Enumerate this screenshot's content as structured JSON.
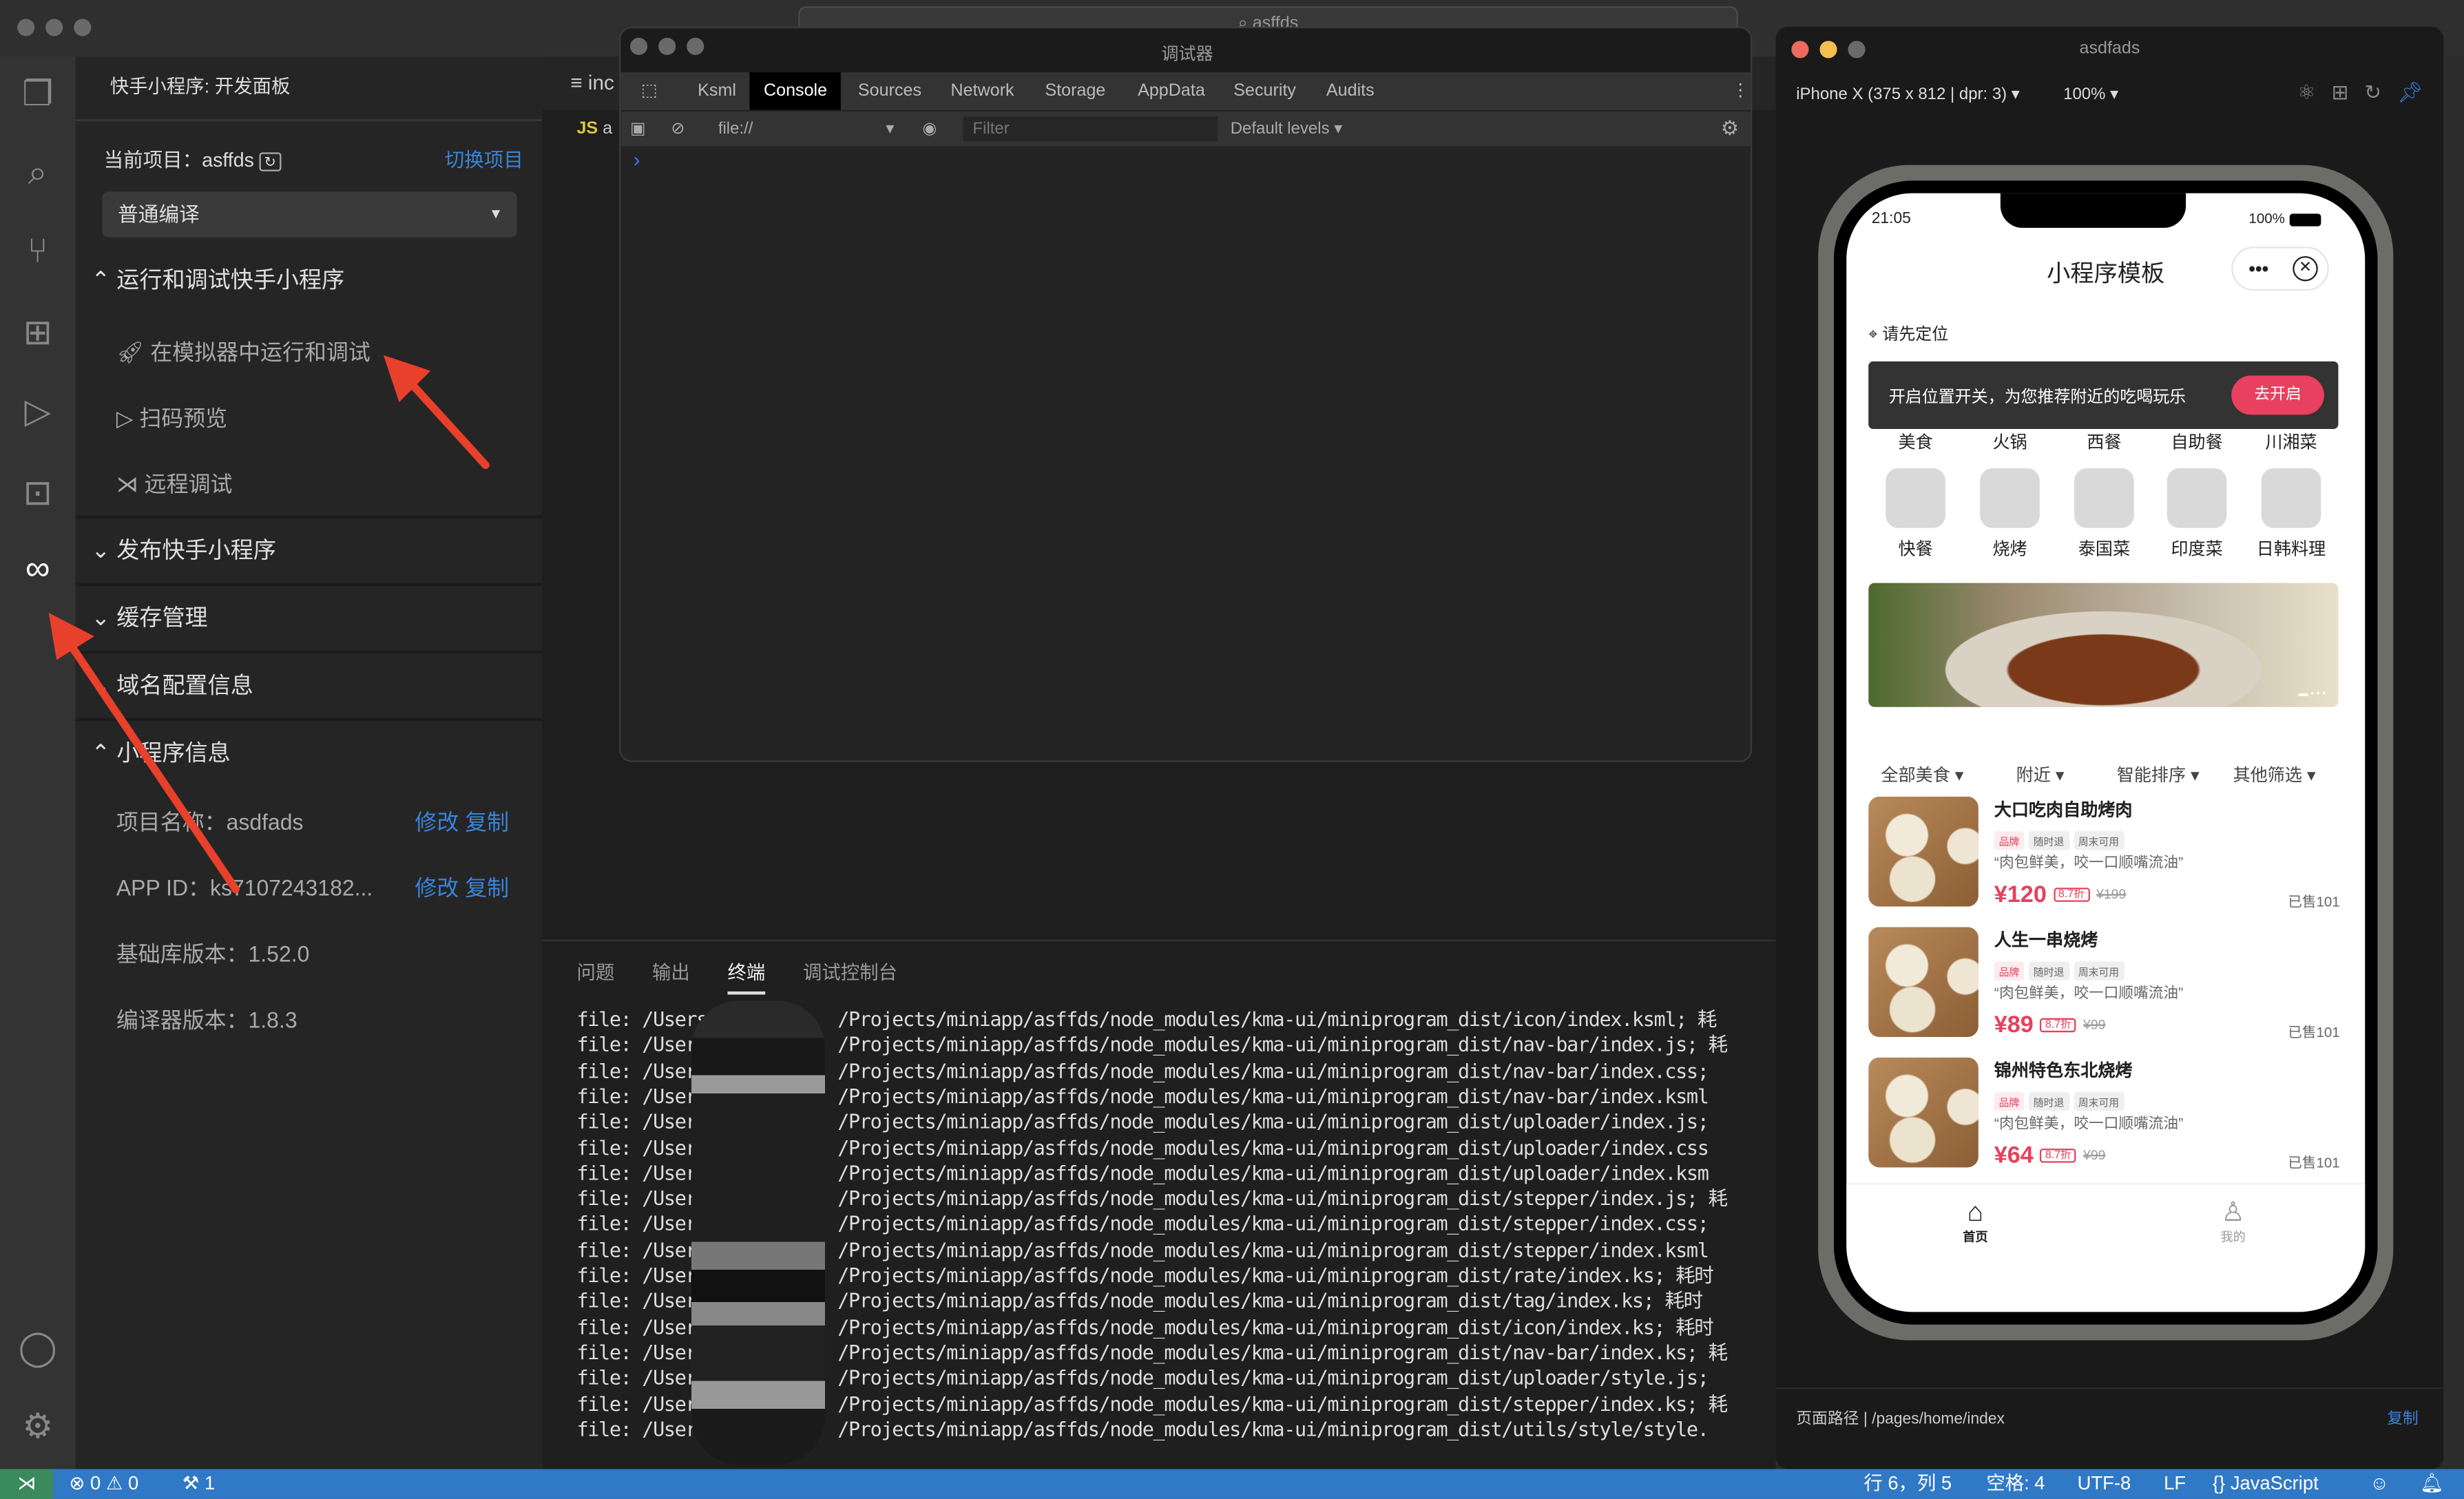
{
  "ide": {
    "sidebar": {
      "title": "快手小程序: 开发面板",
      "current_project_label": "当前项目：",
      "current_project": "asffds",
      "switch_project": "切换项目",
      "compile_mode": "普通编译",
      "sections": [
        {
          "label": "运行和调试快手小程序",
          "expanded": true,
          "items": [
            "在模拟器中运行和调试",
            "扫码预览",
            "远程调试"
          ]
        },
        {
          "label": "发布快手小程序",
          "expanded": false
        },
        {
          "label": "缓存管理",
          "expanded": false
        },
        {
          "label": "域名配置信息",
          "expanded": false
        },
        {
          "label": "小程序信息",
          "expanded": true
        }
      ],
      "info": {
        "name_label": "项目名称：",
        "name": "asdfads",
        "appid_label": "APP ID：",
        "appid": "ks7107243182...",
        "edit": "修改",
        "copy": "复制",
        "lib_version": "基础库版本：1.52.0",
        "compiler_version": "编译器版本：1.8.3"
      }
    },
    "editor": {
      "tab": "inc",
      "js_badge": "JS",
      "file_prefix": "a"
    },
    "search_box": "asffds",
    "panel": {
      "tabs": [
        "问题",
        "输出",
        "终端",
        "调试控制台"
      ],
      "active_tab": "终端",
      "prefix": "file: /Users",
      "lines": [
        "/Projects/miniapp/asffds/node_modules/kma-ui/miniprogram_dist/icon/index.ksml; 耗",
        "/Projects/miniapp/asffds/node_modules/kma-ui/miniprogram_dist/nav-bar/index.js; 耗",
        "/Projects/miniapp/asffds/node_modules/kma-ui/miniprogram_dist/nav-bar/index.css;",
        "/Projects/miniapp/asffds/node_modules/kma-ui/miniprogram_dist/nav-bar/index.ksml",
        "/Projects/miniapp/asffds/node_modules/kma-ui/miniprogram_dist/uploader/index.js;",
        "/Projects/miniapp/asffds/node_modules/kma-ui/miniprogram_dist/uploader/index.css",
        "/Projects/miniapp/asffds/node_modules/kma-ui/miniprogram_dist/uploader/index.ksm",
        "/Projects/miniapp/asffds/node_modules/kma-ui/miniprogram_dist/stepper/index.js; 耗",
        "/Projects/miniapp/asffds/node_modules/kma-ui/miniprogram_dist/stepper/index.css;",
        "/Projects/miniapp/asffds/node_modules/kma-ui/miniprogram_dist/stepper/index.ksml",
        "/Projects/miniapp/asffds/node_modules/kma-ui/miniprogram_dist/rate/index.ks; 耗时",
        "/Projects/miniapp/asffds/node_modules/kma-ui/miniprogram_dist/tag/index.ks; 耗时",
        "/Projects/miniapp/asffds/node_modules/kma-ui/miniprogram_dist/icon/index.ks; 耗时",
        "/Projects/miniapp/asffds/node_modules/kma-ui/miniprogram_dist/nav-bar/index.ks; 耗",
        "/Projects/miniapp/asffds/node_modules/kma-ui/miniprogram_dist/uploader/style.js;",
        "/Projects/miniapp/asffds/node_modules/kma-ui/miniprogram_dist/stepper/index.ks; 耗",
        "/Projects/miniapp/asffds/node_modules/kma-ui/miniprogram_dist/utils/style/style."
      ]
    },
    "statusbar": {
      "errors": "0",
      "warnings": "0",
      "ports": "1",
      "position": "行 6，列 5",
      "spaces": "空格: 4",
      "encoding": "UTF-8",
      "eol": "LF",
      "language": "JavaScript"
    }
  },
  "devtools": {
    "title": "调试器",
    "tabs": [
      "Ksml",
      "Console",
      "Sources",
      "Network",
      "Storage",
      "AppData",
      "Security",
      "Audits"
    ],
    "active_tab": "Console",
    "context": "file://",
    "filter_placeholder": "Filter",
    "levels": "Default levels ▾",
    "prompt": "›"
  },
  "simulator": {
    "title": "asdfads",
    "device": "iPhone X (375 x 812 | dpr: 3) ▾",
    "zoom": "100% ▾",
    "path_label": "页面路径",
    "path": "/pages/home/index",
    "copy": "复制",
    "app": {
      "time": "21:05",
      "battery": "100%",
      "nav_title": "小程序模板",
      "location": "请先定位",
      "banner_text": "开启位置开关，为您推荐附近的吃喝玩乐",
      "banner_button": "去开启",
      "categories_row1": [
        "美食",
        "火锅",
        "西餐",
        "自助餐",
        "川湘菜"
      ],
      "categories_row2": [
        "快餐",
        "烧烤",
        "泰国菜",
        "印度菜",
        "日韩料理"
      ],
      "filters": [
        "全部美食 ▾",
        "附近 ▾",
        "智能排序 ▾",
        "其他筛选 ▾"
      ],
      "items": [
        {
          "name": "大口吃肉自助烤肉",
          "tags": [
            "品牌",
            "随时退",
            "周末可用"
          ],
          "desc": "“肉包鲜美，咬一口顺嘴流油”",
          "price": "¥120",
          "discount": "8.7折",
          "original": "¥199",
          "sold": "已售101"
        },
        {
          "name": "人生一串烧烤",
          "tags": [
            "品牌",
            "随时退",
            "周末可用"
          ],
          "desc": "“肉包鲜美，咬一口顺嘴流油”",
          "price": "¥89",
          "discount": "8.7折",
          "original": "¥99",
          "sold": "已售101"
        },
        {
          "name": "锦州特色东北烧烤",
          "tags": [
            "品牌",
            "随时退",
            "周末可用"
          ],
          "desc": "“肉包鲜美，咬一口顺嘴流油”",
          "price": "¥64",
          "discount": "8.7折",
          "original": "¥99",
          "sold": "已售101"
        }
      ],
      "tabbar": [
        "首页",
        "我的"
      ]
    }
  },
  "colors": {
    "accent": "#3a84d8",
    "status": "#3079c7",
    "price": "#e8405e",
    "arrow": "#e8402a"
  }
}
